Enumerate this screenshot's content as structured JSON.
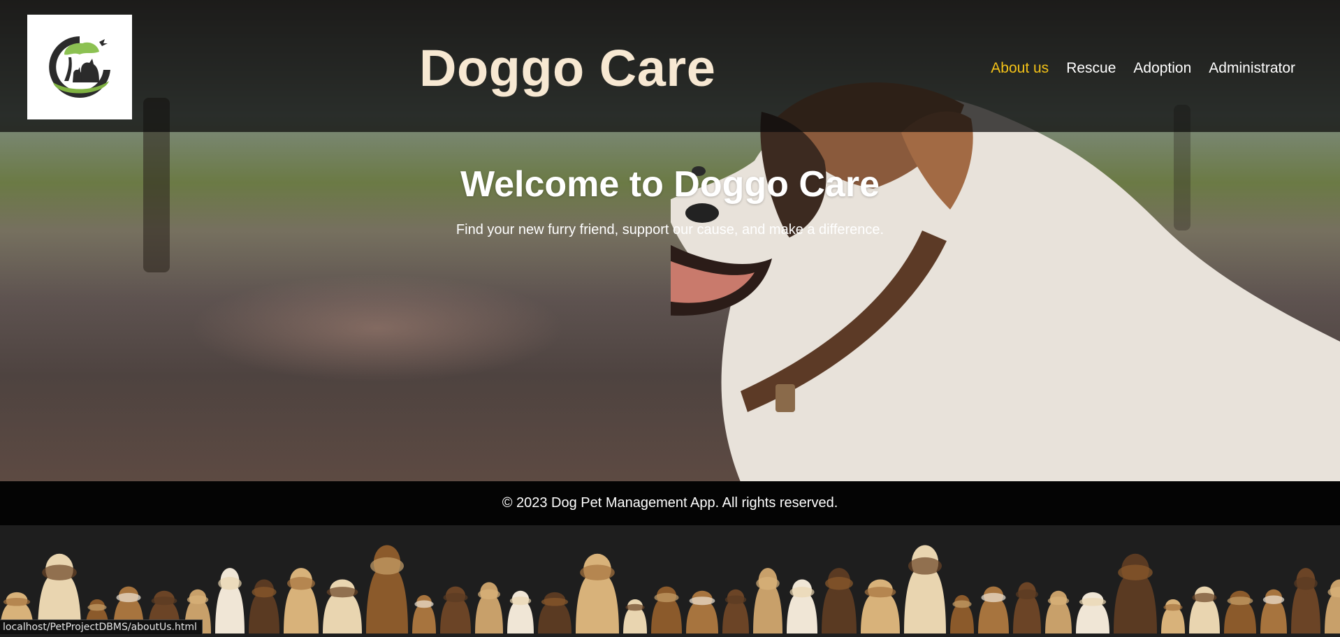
{
  "header": {
    "site_title": "Doggo Care",
    "nav": [
      {
        "label": "About us",
        "active": true
      },
      {
        "label": "Rescue"
      },
      {
        "label": "Adoption"
      },
      {
        "label": "Administrator"
      }
    ]
  },
  "hero": {
    "heading": "Welcome to Doggo Care",
    "subheading": "Find your new furry friend, support our cause, and make a difference."
  },
  "footer": {
    "copyright": "© 2023 Dog Pet Management App. All rights reserved."
  },
  "status_bar": {
    "url": "localhost/PetProjectDBMS/aboutUs.html"
  },
  "colors": {
    "nav_active": "#f3c218",
    "title": "#f7e8d2",
    "header_bg": "rgba(10,10,10,0.72)",
    "footer_bg": "#040404"
  }
}
